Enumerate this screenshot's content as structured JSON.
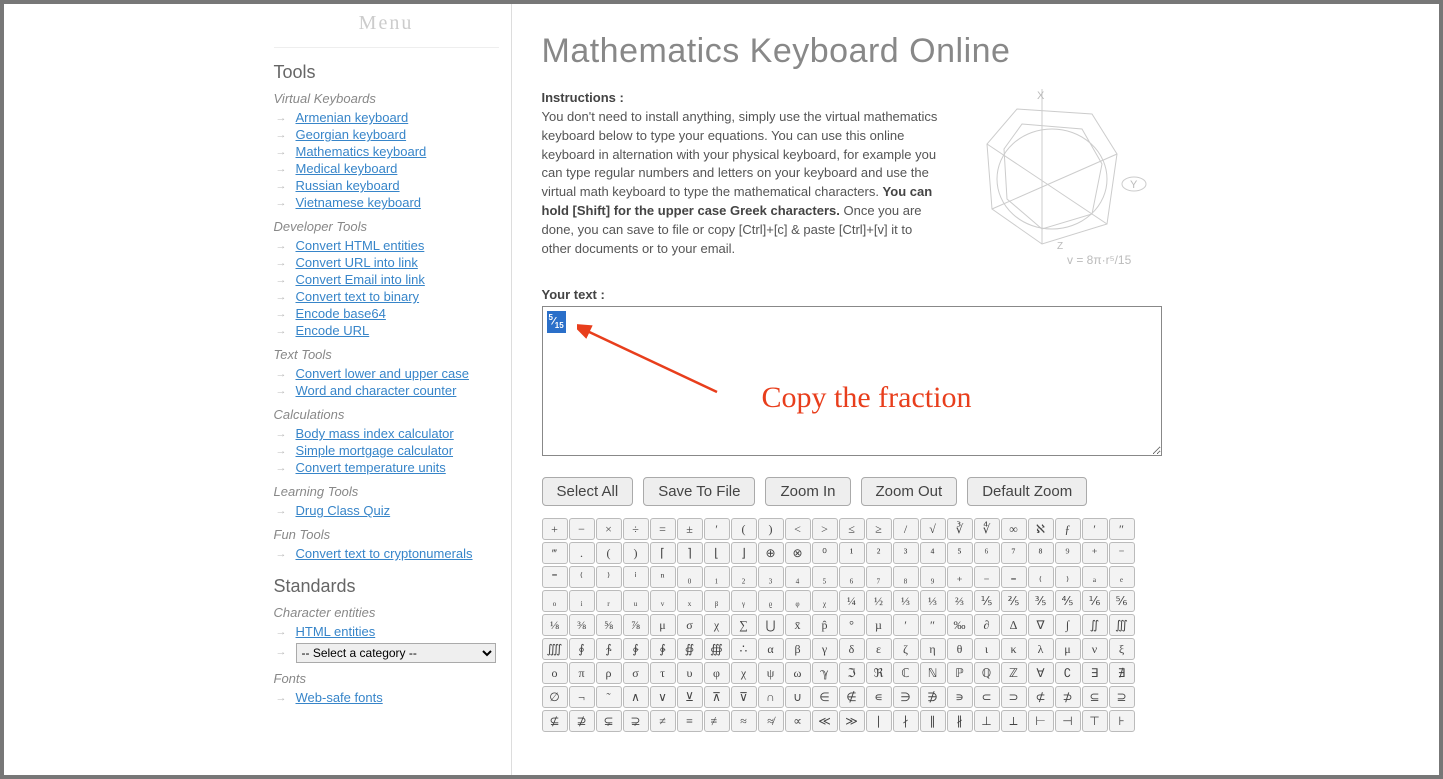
{
  "menuHeader": "Menu",
  "sidebar": {
    "toolsTitle": "Tools",
    "groups": [
      {
        "title": "Virtual Keyboards",
        "items": [
          "Armenian keyboard",
          "Georgian keyboard",
          "Mathematics keyboard",
          "Medical keyboard",
          "Russian keyboard",
          "Vietnamese keyboard"
        ]
      },
      {
        "title": "Developer Tools",
        "items": [
          "Convert HTML entities",
          "Convert URL into link",
          "Convert Email into link",
          "Convert text to binary",
          "Encode base64",
          "Encode URL"
        ]
      },
      {
        "title": "Text Tools",
        "items": [
          "Convert lower and upper case",
          "Word and character counter"
        ]
      },
      {
        "title": "Calculations",
        "items": [
          "Body mass index calculator",
          "Simple mortgage calculator",
          "Convert temperature units"
        ]
      },
      {
        "title": "Learning Tools",
        "items": [
          "Drug Class Quiz"
        ]
      },
      {
        "title": "Fun Tools",
        "items": [
          "Convert text to cryptonumerals"
        ]
      }
    ],
    "standardsTitle": "Standards",
    "charEntTitle": "Character entities",
    "charEntItems": [
      "HTML entities"
    ],
    "selectPlaceholder": "-- Select a category --",
    "fontsTitle": "Fonts",
    "fontsItems": [
      "Web-safe fonts"
    ]
  },
  "page": {
    "title": "Mathematics Keyboard Online",
    "instrLabel": "Instructions :",
    "instrPart1": "You don't need to install anything, simply use the virtual mathematics keyboard below to type your equations. You can use this online keyboard in alternation with your physical keyboard, for example you can type regular numbers and letters on your keyboard and use the virtual math keyboard to type the mathematical characters. ",
    "instrBold": "You can hold [Shift] for the upper case Greek characters.",
    "instrPart2": " Once you are done, you can save to file or copy [Ctrl]+[c] & paste [Ctrl]+[v] it to other documents or to your email.",
    "diagramFormula": "v = 8π·r⁵/15",
    "yourTextLabel": "Your text :",
    "textValue": "⁵⁄₁₅",
    "selectedFraction": {
      "num": "5",
      "den": "15"
    },
    "annotation": "Copy the fraction",
    "buttons": {
      "selectAll": "Select All",
      "saveToFile": "Save To File",
      "zoomIn": "Zoom In",
      "zoomOut": "Zoom Out",
      "defaultZoom": "Default Zoom"
    },
    "keyboardRows": [
      [
        "+",
        "−",
        "×",
        "÷",
        "=",
        "±",
        "′",
        "(",
        ")",
        "<",
        ">",
        "≤",
        "≥",
        "/",
        "√",
        "∛",
        "∜",
        "∞",
        "ℵ",
        "ƒ",
        "′",
        "″"
      ],
      [
        "‴",
        ".",
        "(",
        ")",
        "⌈",
        "⌉",
        "⌊",
        "⌋",
        "⊕",
        "⊗",
        "⁰",
        "¹",
        "²",
        "³",
        "⁴",
        "⁵",
        "⁶",
        "⁷",
        "⁸",
        "⁹",
        "⁺",
        "⁻"
      ],
      [
        "⁼",
        "⁽",
        "⁾",
        "ⁱ",
        "ⁿ",
        "₀",
        "₁",
        "₂",
        "₃",
        "₄",
        "₅",
        "₆",
        "₇",
        "₈",
        "₉",
        "₊",
        "₋",
        "₌",
        "₍",
        "₎",
        "ₐ",
        "ₑ"
      ],
      [
        "ₒ",
        "ᵢ",
        "ᵣ",
        "ᵤ",
        "ᵥ",
        "ₓ",
        "ᵦ",
        "ᵧ",
        "ᵨ",
        "ᵩ",
        "ᵪ",
        "¼",
        "½",
        "⅓",
        "⅓",
        "⅔",
        "⅕",
        "⅖",
        "⅗",
        "⅘",
        "⅙",
        "⅚"
      ],
      [
        "⅛",
        "⅜",
        "⅝",
        "⅞",
        "μ",
        "σ",
        "χ",
        "∑",
        "⋃",
        "x̄",
        "p̂",
        "°",
        "µ",
        "′",
        "″",
        "‰",
        "∂",
        "∆",
        "∇",
        "∫",
        "∬",
        "∭"
      ],
      [
        "⨌",
        "∮",
        "∱",
        "∲",
        "∳",
        "∯",
        "∰",
        "∴",
        "α",
        "β",
        "γ",
        "δ",
        "ε",
        "ζ",
        "η",
        "θ",
        "ι",
        "κ",
        "λ",
        "μ",
        "ν",
        "ξ"
      ],
      [
        "ο",
        "π",
        "ρ",
        "σ",
        "τ",
        "υ",
        "φ",
        "χ",
        "ψ",
        "ω",
        "ℽ",
        "ℑ",
        "ℜ",
        "ℂ",
        "ℕ",
        "ℙ",
        "ℚ",
        "ℤ",
        "∀",
        "∁",
        "∃",
        "∄"
      ],
      [
        "∅",
        "¬",
        "˜",
        "∧",
        "∨",
        "⊻",
        "⊼",
        "⊽",
        "∩",
        "∪",
        "∈",
        "∉",
        "∊",
        "∋",
        "∌",
        "∍",
        "⊂",
        "⊃",
        "⊄",
        "⊅",
        "⊆",
        "⊇"
      ],
      [
        "⊈",
        "⊉",
        "⊊",
        "⊋",
        "≠",
        "≡",
        "≢",
        "≈",
        "≉",
        "∝",
        "≪",
        "≫",
        "∣",
        "∤",
        "∥",
        "∦",
        "⊥",
        "⟂",
        "⊢",
        "⊣",
        "⊤",
        "⊦"
      ]
    ]
  }
}
